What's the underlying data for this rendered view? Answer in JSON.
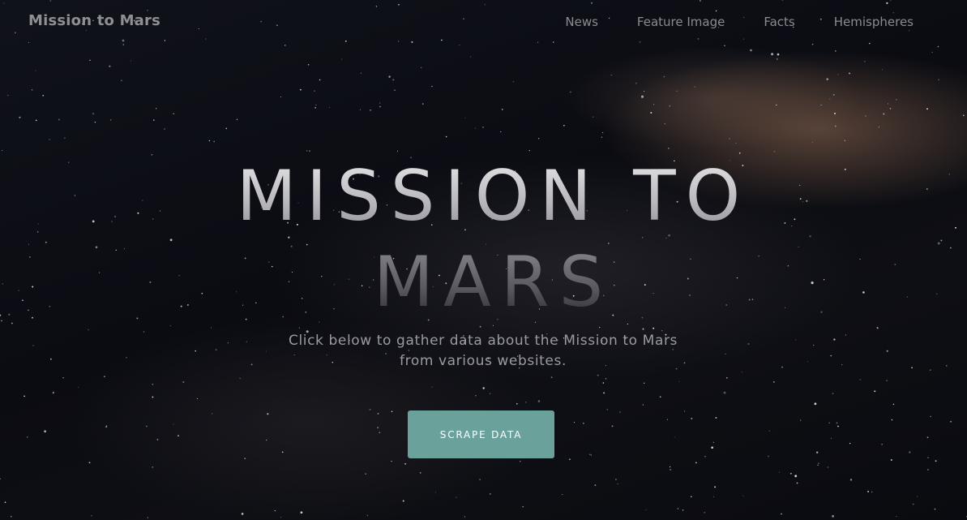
{
  "navbar": {
    "brand": "Mission to Mars",
    "links": [
      {
        "label": "News"
      },
      {
        "label": "Feature Image"
      },
      {
        "label": "Facts"
      },
      {
        "label": "Hemispheres"
      }
    ]
  },
  "hero": {
    "title_line1": "MISSION TO",
    "title_line2": "MARS",
    "subtitle": "Click below to gather data about the Mission to Mars from various websites.",
    "button_label": "SCRAPE DATA"
  },
  "colors": {
    "background": "#0b0c12",
    "button": "#6aa19b",
    "nav_text": "#8a8b91"
  }
}
